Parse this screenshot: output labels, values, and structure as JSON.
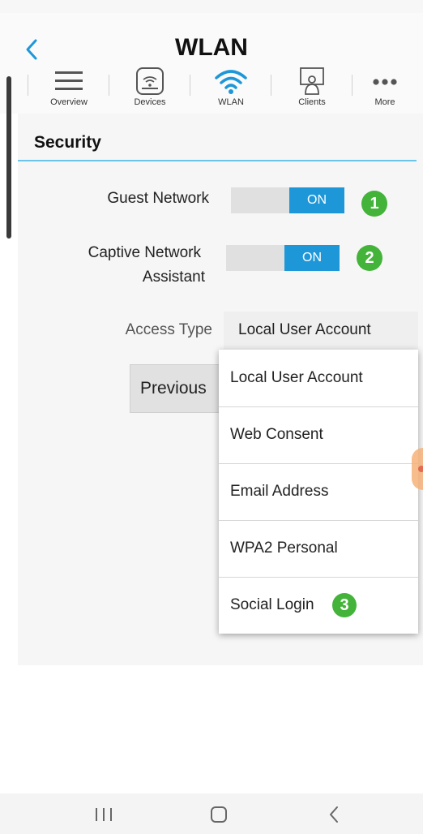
{
  "header": {
    "title": "WLAN"
  },
  "nav": {
    "items": [
      {
        "label": "Overview",
        "icon": "menu-icon"
      },
      {
        "label": "Devices",
        "icon": "router-icon"
      },
      {
        "label": "WLAN",
        "icon": "wifi-icon"
      },
      {
        "label": "Clients",
        "icon": "clients-icon"
      },
      {
        "label": "More",
        "icon": "more-icon"
      }
    ],
    "active": "WLAN"
  },
  "security": {
    "title": "Security",
    "guest_network": {
      "label": "Guest Network",
      "state": "ON",
      "step": "1"
    },
    "captive_assistant": {
      "label_line1": "Captive Network",
      "label_line2": "Assistant",
      "state": "ON",
      "step": "2"
    },
    "access_type": {
      "label": "Access Type",
      "value": "Local User Account"
    },
    "previous_label": "Previous"
  },
  "dropdown": {
    "options": [
      "Local User Account",
      "Web Consent",
      "Email Address",
      "WPA2 Personal",
      "Social Login"
    ],
    "step": "3"
  },
  "colors": {
    "accent": "#1e97d8",
    "badge": "#43b33a",
    "rule": "#6cc4ea"
  }
}
